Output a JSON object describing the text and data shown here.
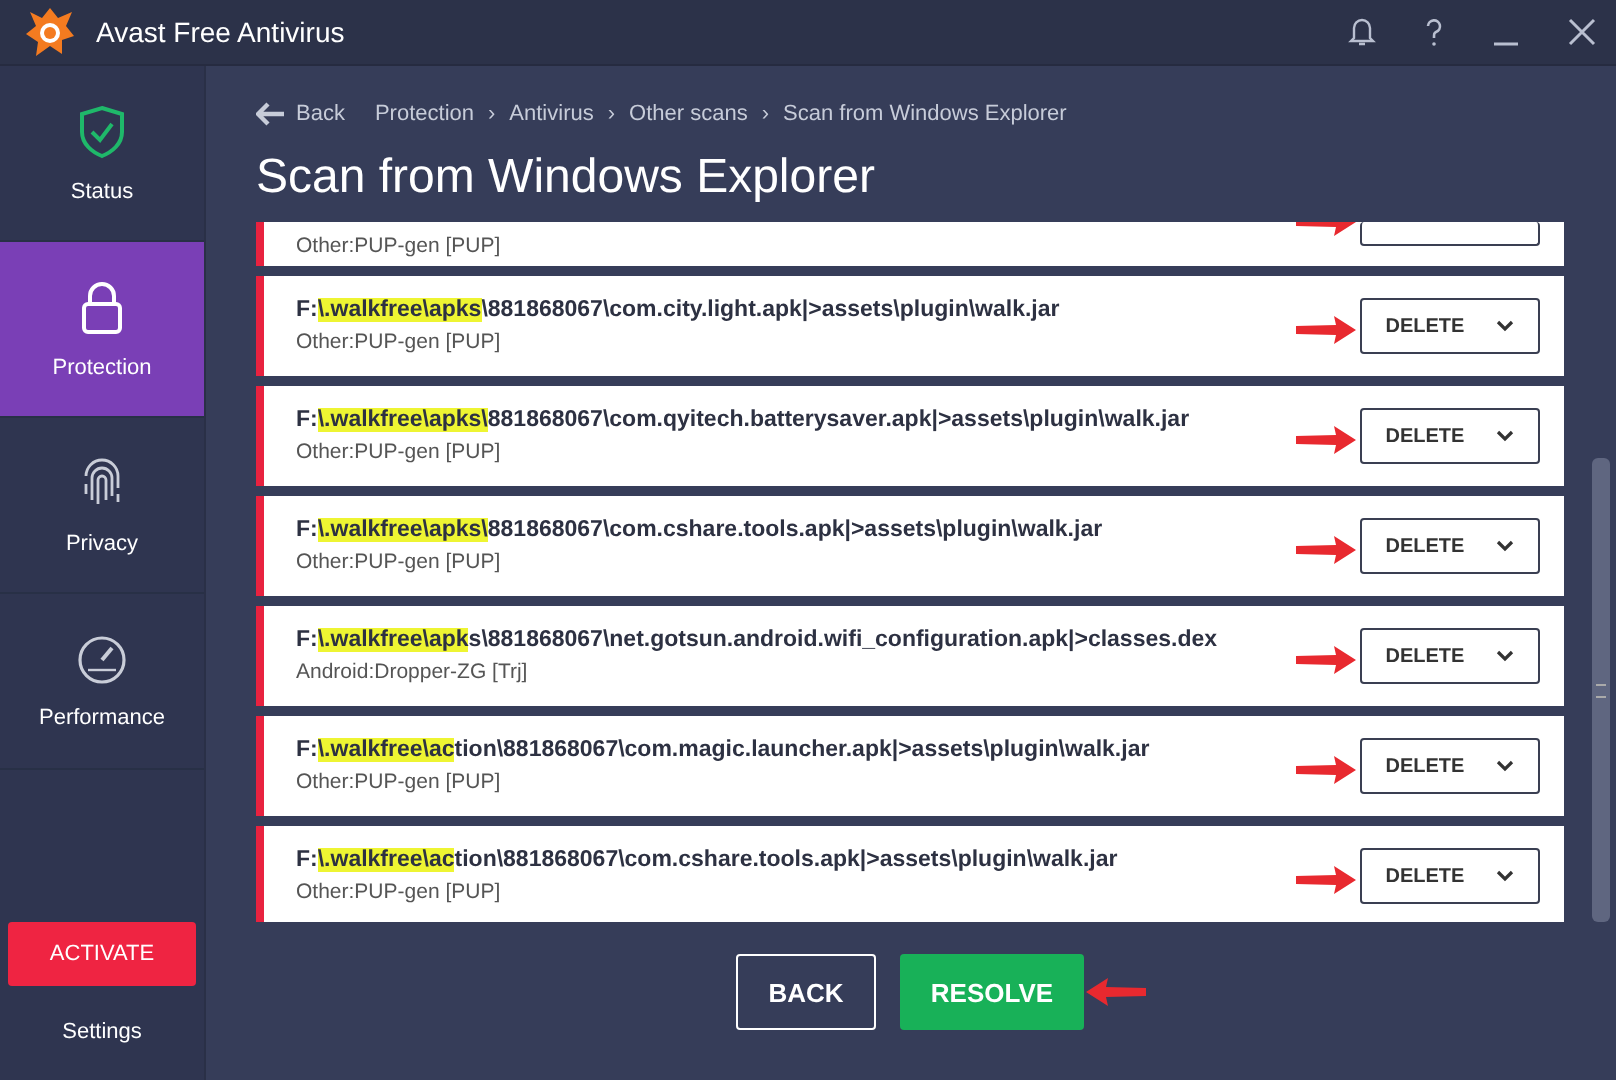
{
  "window": {
    "title": "Avast Free Antivirus"
  },
  "sidebar": {
    "items": [
      {
        "label": "Status",
        "kind": "shield",
        "selected": false
      },
      {
        "label": "Protection",
        "kind": "lock",
        "selected": true
      },
      {
        "label": "Privacy",
        "kind": "fingerprint",
        "selected": false
      },
      {
        "label": "Performance",
        "kind": "gauge",
        "selected": false
      }
    ],
    "activate_button": "ACTIVATE",
    "settings": "Settings"
  },
  "breadcrumb": {
    "back": "Back",
    "separator": "›",
    "trail": [
      "Protection",
      "Antivirus",
      "Other scans",
      "Scan from Windows Explorer"
    ]
  },
  "page_title": "Scan from Windows Explorer",
  "results": [
    {
      "detection": "Other:PUP-gen [PUP]",
      "annotated": true
    },
    {
      "path_parts": [
        {
          "text": "F:",
          "highlighted": false
        },
        {
          "text": "\\.walkfree\\apks",
          "highlighted": true
        },
        {
          "text": "\\881868067\\com.city.light.apk|>assets\\plugin\\walk.jar",
          "highlighted": false
        }
      ],
      "detection": "Other:PUP-gen [PUP]",
      "action": "DELETE",
      "annotated": true
    },
    {
      "path_parts": [
        {
          "text": "F:",
          "highlighted": false
        },
        {
          "text": "\\.walkfree\\apks\\",
          "highlighted": true
        },
        {
          "text": "881868067\\com.qyitech.batterysaver.apk|>assets\\plugin\\walk.jar",
          "highlighted": false
        }
      ],
      "detection": "Other:PUP-gen [PUP]",
      "action": "DELETE",
      "annotated": true
    },
    {
      "path_parts": [
        {
          "text": "F:",
          "highlighted": false
        },
        {
          "text": "\\.walkfree\\apks\\",
          "highlighted": true
        },
        {
          "text": "881868067\\com.cshare.tools.apk|>assets\\plugin\\walk.jar",
          "highlighted": false
        }
      ],
      "detection": "Other:PUP-gen [PUP]",
      "action": "DELETE",
      "annotated": true
    },
    {
      "path_parts": [
        {
          "text": "F:",
          "highlighted": false
        },
        {
          "text": "\\.walkfree\\apk",
          "highlighted": true
        },
        {
          "text": "s\\881868067\\net.gotsun.android.wifi_configuration.apk|>classes.dex",
          "highlighted": false
        }
      ],
      "detection": "Android:Dropper-ZG [Trj]",
      "action": "DELETE",
      "annotated": true
    },
    {
      "path_parts": [
        {
          "text": "F:",
          "highlighted": false
        },
        {
          "text": "\\.walkfree\\ac",
          "highlighted": true
        },
        {
          "text": "tion\\881868067\\com.magic.launcher.apk|>assets\\plugin\\walk.jar",
          "highlighted": false
        }
      ],
      "detection": "Other:PUP-gen [PUP]",
      "action": "DELETE",
      "annotated": true
    },
    {
      "path_parts": [
        {
          "text": "F:",
          "highlighted": false
        },
        {
          "text": "\\.walkfree\\ac",
          "highlighted": true
        },
        {
          "text": "tion\\881868067\\com.cshare.tools.apk|>assets\\plugin\\walk.jar",
          "highlighted": false
        }
      ],
      "detection": "Other:PUP-gen [PUP]",
      "action": "DELETE",
      "annotated": true
    }
  ],
  "footer": {
    "back_button": "BACK",
    "resolve_button": "RESOLVE",
    "resolve_annotated": true
  }
}
